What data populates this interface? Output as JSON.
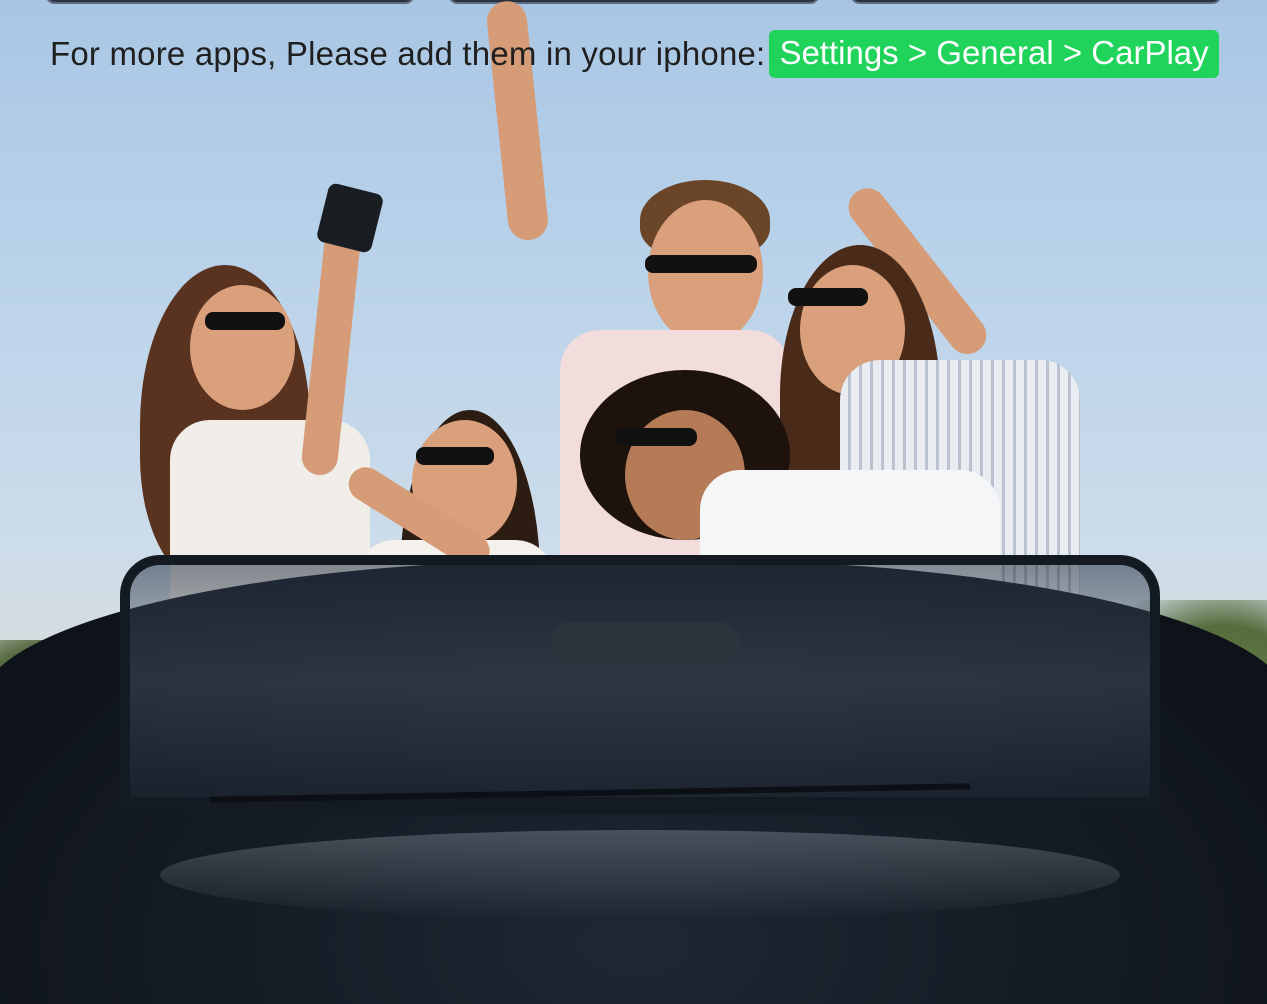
{
  "caption": {
    "text": "For more apps, Please add them in your iphone:",
    "path": "Settings > General > CarPlay"
  },
  "colors": {
    "path_highlight": "#1fd35b",
    "caption_text": "#1f1f1f",
    "sky": "#b9d2ea",
    "car": "#131922"
  },
  "image": {
    "description_icon": "photo-friends-in-convertible"
  }
}
